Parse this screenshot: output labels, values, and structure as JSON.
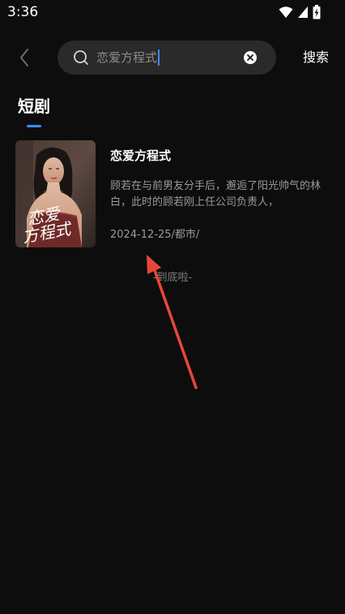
{
  "status_bar": {
    "time": "3:36"
  },
  "search": {
    "query": "恋爱方程式",
    "submit_label": "搜索"
  },
  "section": {
    "title": "短剧"
  },
  "results": [
    {
      "title": "恋爱方程式",
      "description": "顾若在与前男友分手后，邂逅了阳光帅气的林白，此时的顾若刚上任公司负责人，",
      "meta": "2024-12-25/都市/",
      "poster_title": "恋爱方程式"
    }
  ],
  "end_note": "-到底啦-",
  "colors": {
    "background": "#0d0d0d",
    "search_box": "#2a2a2a",
    "accent": "#3b8cff",
    "annotation_arrow": "#e8463a"
  },
  "icons": {
    "back": "chevron-left-icon",
    "search": "search-icon",
    "clear": "close-icon",
    "wifi": "wifi-icon",
    "signal": "signal-icon",
    "battery": "battery-icon"
  }
}
